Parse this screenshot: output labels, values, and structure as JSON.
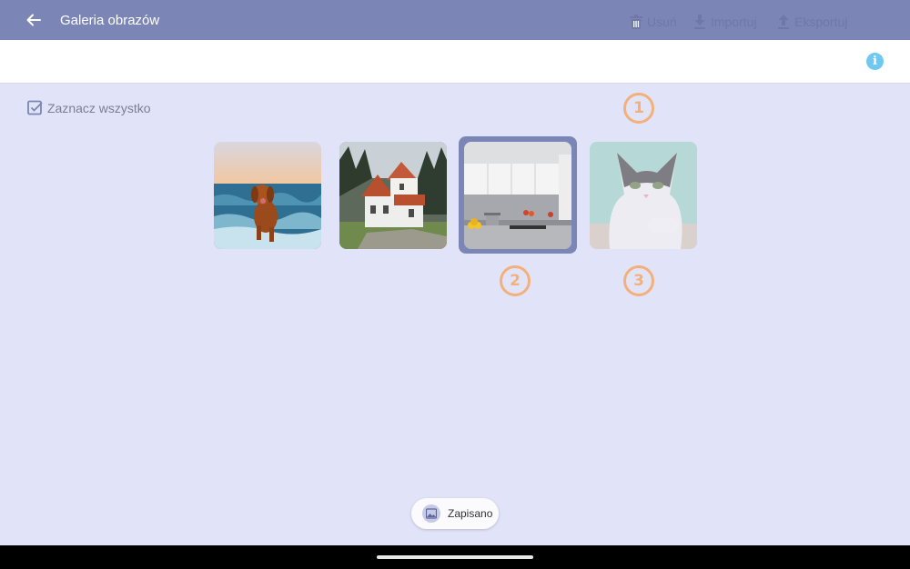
{
  "app_bar": {
    "title": "Galeria obrazów",
    "back_icon": "arrow-left-icon"
  },
  "toolbar": {
    "delete_label": "Usuń",
    "import_label": "Importuj",
    "export_label": "Eksportuj",
    "info_label": "i"
  },
  "select_all": {
    "label": "Zaznacz wszystko"
  },
  "gallery": {
    "images": [
      {
        "subject": "dog running in sea waves",
        "selected": false
      },
      {
        "subject": "white house with red roof",
        "selected": false
      },
      {
        "subject": "modern kitchen",
        "selected": true
      },
      {
        "subject": "cat",
        "selected": false,
        "dimmed": true
      }
    ]
  },
  "annotations": [
    "1",
    "2",
    "3"
  ],
  "toast": {
    "label": "Zapisano"
  },
  "colors": {
    "app_bar": "#7b86b7",
    "background": "#e1e4f8",
    "toolbar_text": "#6f78a8",
    "info": "#6fc8f2",
    "annotation": "#f3b07b"
  }
}
